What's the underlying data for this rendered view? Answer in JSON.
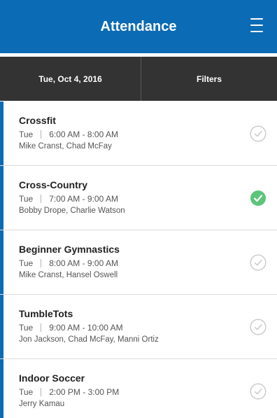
{
  "header": {
    "title": "Attendance",
    "menu_icon": "hamburger-menu-icon",
    "color": "#0b6bb4"
  },
  "toolbar": {
    "date": "Tue, Oct 4, 2016",
    "filters_label": "Filters",
    "background": "#333333"
  },
  "classes": [
    {
      "name": "Crossfit",
      "day": "Tue",
      "time": "6:00 AM - 8:00 AM",
      "instructors": "Mike Cranst,  Chad McFay",
      "checked": false
    },
    {
      "name": "Cross-Country",
      "day": "Tue",
      "time": "7:00 AM - 9:00 AM",
      "instructors": "Bobby Drope,  Charlie Watson",
      "checked": true
    },
    {
      "name": "Beginner Gymnastics",
      "day": "Tue",
      "time": "8:00 AM - 9:00 AM",
      "instructors": "Mike Cranst,  Hansel Oswell",
      "checked": false
    },
    {
      "name": "TumbleTots",
      "day": "Tue",
      "time": "9:00 AM - 10:00 AM",
      "instructors": "Jon Jackson,  Chad McFay,  Manni Ortiz",
      "checked": false
    },
    {
      "name": "Indoor Soccer",
      "day": "Tue",
      "time": "2:00 PM - 3:00 PM",
      "instructors": "Jerry Kamau",
      "checked": false
    }
  ],
  "colors": {
    "accent": "#0b6bb4",
    "checked": "#5cc57a",
    "unchecked": "#c9c9c9"
  }
}
